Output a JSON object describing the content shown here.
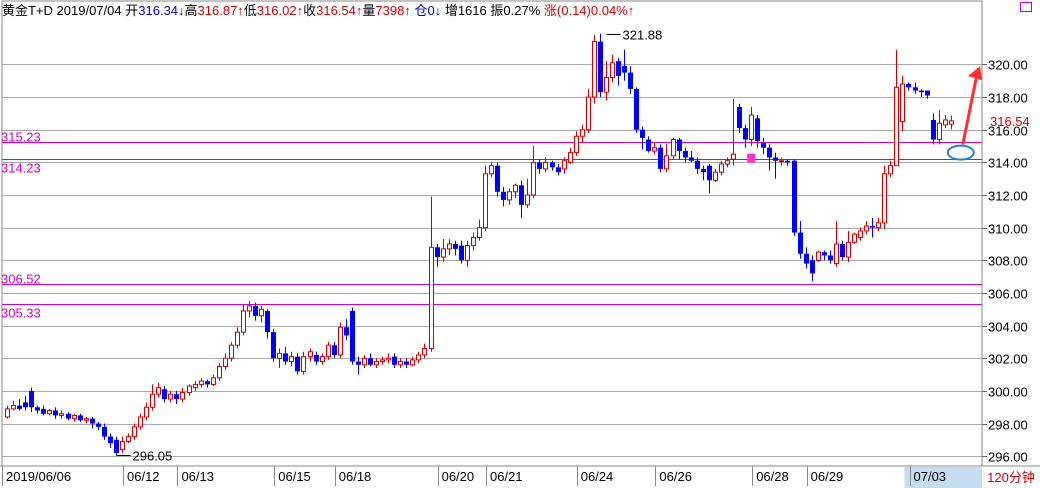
{
  "header": {
    "symbol": "黄金T+D",
    "date": "2019/07/04",
    "open_label": "开",
    "open": "316.34↓",
    "high_label": "高",
    "high": "316.87↑",
    "low_label": "低",
    "low": "316.02↑",
    "close_label": "收",
    "close": "316.54↑",
    "volume_label": "量",
    "volume": "7398↑",
    "oi_label": "仓",
    "oi": "0↓",
    "increase_label": "增",
    "increase": "1616",
    "amplitude_label": "振",
    "amplitude": "0.27%",
    "change_label": "涨",
    "change": "(0.14)",
    "change_pct": "0.04%↑"
  },
  "period_label": "120分钟",
  "colors": {
    "up": "#cc0000",
    "down": "#0000ff",
    "support_line": "#cc00cc",
    "gridline": "#a8a8a8",
    "arrow": "#ff3030",
    "ellipse": "#2a7fd0",
    "date_highlight": "#c8dcf0"
  },
  "chart_data": {
    "type": "candlestick",
    "ylim": [
      295.4,
      322.6
    ],
    "yticks": [
      296,
      298,
      300,
      302,
      304,
      306,
      308,
      310,
      312,
      314,
      316,
      318,
      320
    ],
    "ytick_labels": [
      "296.00",
      "298.00",
      "300.00",
      "302.00",
      "304.00",
      "306.00",
      "308.00",
      "310.00",
      "312.00",
      "314.00",
      "316.00",
      "318.00",
      "320.00"
    ],
    "current_price": "316.54",
    "date_labels": [
      "2019/06/06",
      "06/12",
      "06/13",
      "06/15",
      "06/18",
      "06/20",
      "06/21",
      "06/24",
      "06/26",
      "06/28",
      "06/29",
      "07/03"
    ],
    "date_label_index": [
      0,
      20,
      29,
      45,
      55,
      72,
      80,
      95,
      108,
      124,
      133,
      150
    ],
    "highlight_date": "07/03",
    "horizontal_levels": [
      {
        "value": 315.23,
        "label": "315.23"
      },
      {
        "value": 314.23,
        "label": "314.23"
      },
      {
        "value": 306.52,
        "label": "306.52"
      },
      {
        "value": 305.33,
        "label": "305.33"
      }
    ],
    "annotations": [
      {
        "text": "321.88",
        "index": 99,
        "value": 321.88
      },
      {
        "text": "296.05",
        "index": 18,
        "value": 296.05
      }
    ],
    "candles": [
      [
        298.4,
        298.9,
        298.3,
        299.1
      ],
      [
        298.9,
        299.1,
        298.8,
        299.4
      ],
      [
        299.1,
        298.9,
        298.8,
        299.5
      ],
      [
        299.3,
        299.0,
        298.8,
        299.7
      ],
      [
        300.0,
        299.0,
        298.7,
        300.2
      ],
      [
        299.0,
        298.8,
        298.6,
        299.1
      ],
      [
        298.9,
        298.6,
        298.5,
        299.1
      ],
      [
        298.6,
        298.8,
        298.5,
        298.9
      ],
      [
        298.8,
        298.5,
        298.3,
        299.0
      ],
      [
        298.5,
        298.6,
        298.3,
        298.8
      ],
      [
        298.6,
        298.3,
        298.2,
        298.7
      ],
      [
        298.3,
        298.5,
        298.1,
        298.6
      ],
      [
        298.5,
        298.2,
        298.1,
        298.6
      ],
      [
        298.2,
        298.3,
        298.0,
        298.4
      ],
      [
        298.3,
        298.0,
        297.7,
        298.4
      ],
      [
        298.0,
        297.8,
        297.6,
        298.1
      ],
      [
        297.8,
        297.2,
        297.0,
        298.0
      ],
      [
        297.2,
        296.8,
        296.5,
        297.4
      ],
      [
        297.0,
        296.2,
        296.05,
        297.2
      ],
      [
        296.4,
        296.9,
        296.2,
        297.2
      ],
      [
        296.9,
        297.2,
        296.8,
        297.4
      ],
      [
        297.2,
        297.8,
        297.0,
        298.0
      ],
      [
        297.8,
        298.4,
        297.6,
        298.6
      ],
      [
        298.4,
        299.0,
        298.2,
        299.3
      ],
      [
        299.0,
        299.8,
        298.8,
        300.4
      ],
      [
        299.8,
        300.2,
        299.6,
        300.5
      ],
      [
        300.1,
        299.5,
        299.3,
        300.3
      ],
      [
        299.5,
        299.8,
        299.3,
        300.0
      ],
      [
        299.8,
        299.5,
        299.2,
        300.0
      ],
      [
        299.5,
        299.9,
        299.3,
        300.2
      ],
      [
        299.9,
        300.3,
        299.7,
        300.4
      ],
      [
        300.2,
        300.4,
        300.0,
        300.6
      ],
      [
        300.4,
        300.6,
        300.2,
        300.8
      ],
      [
        300.6,
        300.4,
        300.2,
        300.7
      ],
      [
        300.4,
        300.8,
        300.3,
        301.0
      ],
      [
        300.8,
        301.5,
        300.6,
        301.7
      ],
      [
        301.5,
        302.0,
        301.3,
        302.3
      ],
      [
        302.0,
        302.8,
        301.8,
        303.0
      ],
      [
        302.8,
        303.6,
        302.6,
        303.9
      ],
      [
        303.6,
        304.9,
        303.4,
        305.3
      ],
      [
        304.9,
        305.2,
        304.5,
        305.5
      ],
      [
        305.2,
        304.6,
        304.3,
        305.4
      ],
      [
        304.6,
        305.0,
        304.2,
        305.2
      ],
      [
        304.9,
        303.6,
        303.2,
        305.0
      ],
      [
        303.6,
        302.0,
        301.8,
        303.8
      ],
      [
        302.0,
        302.3,
        301.4,
        302.6
      ],
      [
        302.3,
        301.8,
        301.6,
        302.7
      ],
      [
        301.8,
        302.1,
        301.5,
        302.4
      ],
      [
        302.1,
        301.2,
        301.0,
        302.3
      ],
      [
        301.2,
        302.1,
        301.0,
        302.4
      ],
      [
        302.1,
        302.4,
        301.8,
        302.6
      ],
      [
        302.2,
        301.8,
        301.6,
        302.4
      ],
      [
        301.8,
        302.1,
        301.6,
        302.3
      ],
      [
        302.1,
        302.8,
        301.9,
        303.0
      ],
      [
        302.8,
        302.2,
        302.0,
        303.0
      ],
      [
        302.2,
        303.9,
        302.0,
        304.2
      ],
      [
        303.9,
        303.4,
        303.1,
        304.4
      ],
      [
        304.9,
        301.8,
        301.6,
        305.1
      ],
      [
        301.8,
        301.6,
        301.0,
        302.1
      ],
      [
        301.6,
        302.0,
        301.4,
        302.2
      ],
      [
        302.0,
        301.6,
        301.5,
        302.3
      ],
      [
        301.6,
        301.8,
        301.4,
        302.0
      ],
      [
        301.8,
        301.9,
        301.6,
        302.1
      ],
      [
        301.9,
        302.0,
        301.7,
        302.3
      ],
      [
        302.1,
        301.6,
        301.4,
        302.3
      ],
      [
        301.6,
        301.8,
        301.4,
        302.0
      ],
      [
        301.8,
        301.6,
        301.4,
        302.0
      ],
      [
        301.6,
        301.9,
        301.5,
        302.1
      ],
      [
        301.9,
        302.2,
        301.7,
        302.4
      ],
      [
        302.2,
        302.6,
        302.0,
        302.9
      ],
      [
        302.6,
        308.8,
        302.4,
        311.9
      ],
      [
        308.8,
        308.2,
        307.6,
        309.0
      ],
      [
        308.2,
        308.7,
        307.9,
        309.3
      ],
      [
        308.7,
        309.0,
        308.3,
        309.3
      ],
      [
        309.0,
        308.7,
        308.3,
        309.2
      ],
      [
        308.9,
        308.0,
        307.8,
        309.2
      ],
      [
        308.0,
        308.9,
        307.6,
        309.2
      ],
      [
        308.9,
        309.4,
        308.6,
        309.7
      ],
      [
        309.4,
        310.0,
        309.2,
        310.5
      ],
      [
        310.0,
        313.3,
        309.8,
        313.8
      ],
      [
        313.3,
        313.8,
        313.1,
        314.0
      ],
      [
        313.8,
        312.2,
        311.9,
        314.0
      ],
      [
        312.2,
        311.7,
        311.3,
        312.5
      ],
      [
        311.7,
        312.2,
        311.4,
        312.4
      ],
      [
        312.2,
        312.6,
        311.8,
        312.7
      ],
      [
        312.6,
        311.4,
        310.6,
        312.9
      ],
      [
        311.4,
        312.0,
        311.2,
        313.0
      ],
      [
        312.0,
        314.0,
        311.8,
        315.0
      ],
      [
        314.0,
        313.6,
        313.3,
        314.2
      ],
      [
        313.6,
        314.0,
        313.4,
        314.3
      ],
      [
        314.0,
        313.7,
        313.5,
        314.1
      ],
      [
        313.7,
        313.4,
        313.2,
        313.9
      ],
      [
        313.6,
        314.1,
        313.3,
        314.3
      ],
      [
        314.0,
        314.6,
        313.9,
        314.9
      ],
      [
        314.6,
        315.6,
        314.4,
        315.9
      ],
      [
        315.6,
        316.0,
        315.2,
        316.3
      ],
      [
        316.0,
        318.0,
        315.8,
        318.5
      ],
      [
        318.0,
        321.4,
        317.6,
        321.8
      ],
      [
        321.4,
        318.3,
        318.0,
        321.88
      ],
      [
        318.3,
        319.2,
        317.8,
        320.2
      ],
      [
        319.2,
        320.1,
        318.9,
        320.6
      ],
      [
        320.2,
        319.3,
        318.7,
        320.4
      ],
      [
        319.9,
        319.5,
        319.0,
        320.9
      ],
      [
        319.5,
        318.5,
        318.2,
        319.9
      ],
      [
        318.5,
        316.0,
        315.8,
        318.6
      ],
      [
        316.0,
        315.5,
        314.8,
        316.2
      ],
      [
        315.4,
        314.7,
        314.6,
        315.6
      ],
      [
        314.7,
        314.9,
        314.5,
        315.2
      ],
      [
        314.9,
        313.6,
        313.4,
        315.1
      ],
      [
        313.6,
        314.4,
        313.4,
        315.1
      ],
      [
        314.4,
        315.4,
        314.2,
        315.5
      ],
      [
        315.4,
        314.7,
        314.2,
        315.5
      ],
      [
        314.7,
        314.3,
        314.0,
        314.9
      ],
      [
        314.3,
        314.1,
        314.0,
        314.7
      ],
      [
        314.1,
        313.6,
        313.3,
        314.3
      ],
      [
        313.6,
        313.4,
        312.9,
        313.8
      ],
      [
        313.8,
        312.9,
        312.1,
        313.9
      ],
      [
        312.9,
        313.4,
        312.8,
        313.6
      ],
      [
        313.4,
        313.9,
        313.2,
        314.1
      ],
      [
        313.9,
        314.1,
        313.7,
        314.3
      ],
      [
        314.2,
        314.5,
        313.8,
        317.9
      ],
      [
        317.4,
        316.1,
        315.8,
        317.6
      ],
      [
        316.1,
        315.4,
        314.9,
        316.3
      ],
      [
        315.4,
        316.9,
        315.0,
        317.4
      ],
      [
        316.7,
        315.3,
        314.9,
        316.9
      ],
      [
        315.2,
        314.9,
        314.5,
        315.5
      ],
      [
        314.9,
        314.3,
        313.5,
        315.1
      ],
      [
        314.3,
        314.1,
        313.0,
        314.6
      ],
      [
        314.1,
        314.1,
        313.8,
        314.3
      ],
      [
        314.1,
        314.0,
        313.8,
        314.2
      ],
      [
        314.1,
        309.7,
        309.5,
        314.2
      ],
      [
        309.7,
        308.4,
        308.1,
        310.4
      ],
      [
        308.4,
        307.8,
        307.5,
        308.8
      ],
      [
        308.0,
        307.2,
        306.7,
        308.3
      ],
      [
        308.0,
        308.5,
        307.9,
        308.6
      ],
      [
        308.5,
        308.3,
        308.0,
        308.6
      ],
      [
        308.3,
        308.0,
        307.8,
        308.6
      ],
      [
        307.8,
        309.0,
        307.6,
        310.4
      ],
      [
        309.0,
        308.2,
        308.0,
        309.2
      ],
      [
        308.2,
        309.1,
        307.9,
        309.8
      ],
      [
        309.1,
        309.6,
        309.0,
        309.7
      ],
      [
        309.4,
        309.8,
        309.2,
        310.0
      ],
      [
        309.8,
        310.1,
        309.6,
        310.4
      ],
      [
        310.1,
        310.0,
        309.4,
        310.6
      ],
      [
        310.0,
        310.3,
        309.8,
        310.6
      ],
      [
        310.3,
        313.3,
        309.9,
        313.8
      ],
      [
        313.3,
        313.8,
        313.1,
        314.1
      ],
      [
        313.8,
        318.6,
        314.0,
        320.9
      ],
      [
        316.5,
        318.8,
        315.9,
        319.3
      ],
      [
        318.8,
        318.6,
        318.4,
        318.9
      ],
      [
        318.6,
        318.4,
        318.2,
        318.9
      ],
      [
        318.4,
        318.3,
        318.0,
        318.5
      ],
      [
        318.4,
        318.1,
        317.9,
        318.4
      ],
      [
        316.6,
        315.4,
        315.1,
        317.0
      ],
      [
        315.4,
        316.4,
        315.1,
        317.2
      ],
      [
        316.3,
        316.6,
        316.1,
        316.9
      ],
      [
        316.34,
        316.54,
        316.02,
        316.87
      ]
    ]
  }
}
